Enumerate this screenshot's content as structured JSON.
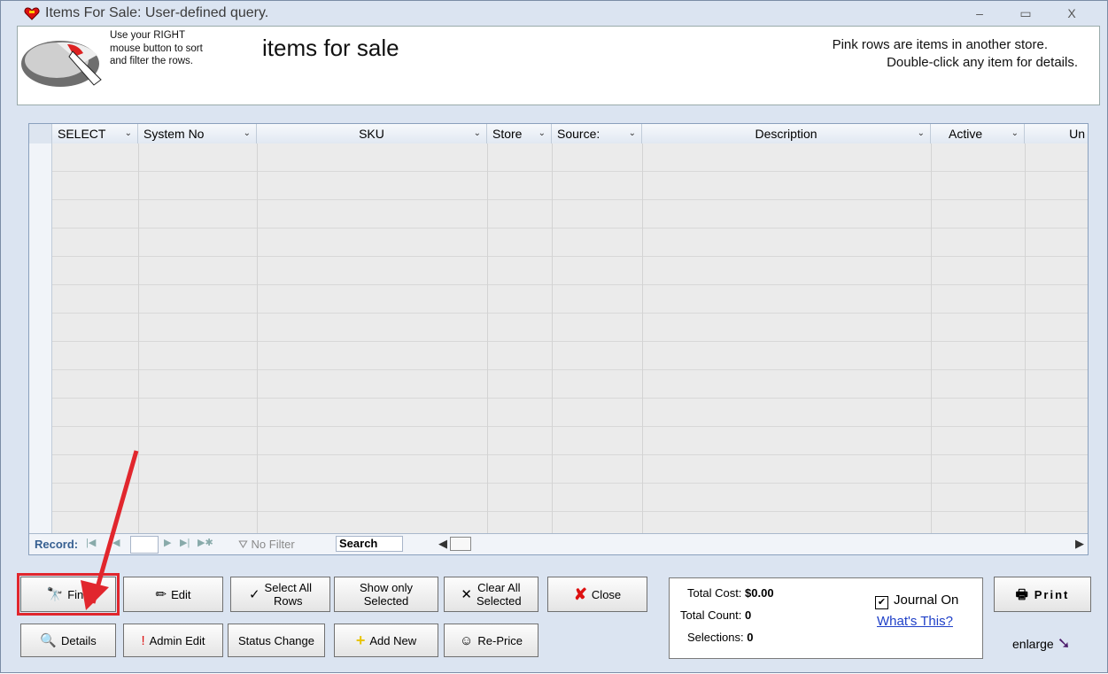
{
  "window": {
    "title": "Items For Sale:  User-defined query.",
    "minimize": "–",
    "maximize": "▭",
    "close": "X"
  },
  "header": {
    "hint_lines": [
      "Use your RIGHT",
      "mouse button to sort",
      "and filter the rows."
    ],
    "title": "items for sale",
    "note_lines": [
      "Pink rows are items in another store.",
      "Double-click any item for details."
    ]
  },
  "grid": {
    "columns": [
      "SELECT",
      "System No",
      "SKU",
      "Store",
      "Source:",
      "Description",
      "Active",
      "Un"
    ],
    "dropdown_glyph": "⌄"
  },
  "navbar": {
    "record_label": "Record:",
    "no_filter": "No Filter",
    "search": "Search"
  },
  "buttons": {
    "find": "Find",
    "edit": "Edit",
    "select_all": "Select All\nRows",
    "show_only": "Show only\nSelected",
    "clear_all": "Clear All\nSelected",
    "close": "Close",
    "details": "Details",
    "admin_edit": "Admin Edit",
    "status_change": "Status Change",
    "add_new": "Add New",
    "reprice": "Re-Price",
    "print": "Print"
  },
  "info": {
    "total_cost_label": "Total Cost:",
    "total_cost": "$0.00",
    "total_count_label": "Total Count:",
    "total_count": "0",
    "selections_label": "Selections:",
    "selections": "0",
    "journal": "Journal On",
    "journal_checked": "✔",
    "whats_this": "What's This?"
  },
  "enlarge": "enlarge",
  "colors": {
    "accent_red": "#e1262d",
    "link": "#1f40c8",
    "frame": "#dbe4f1"
  }
}
